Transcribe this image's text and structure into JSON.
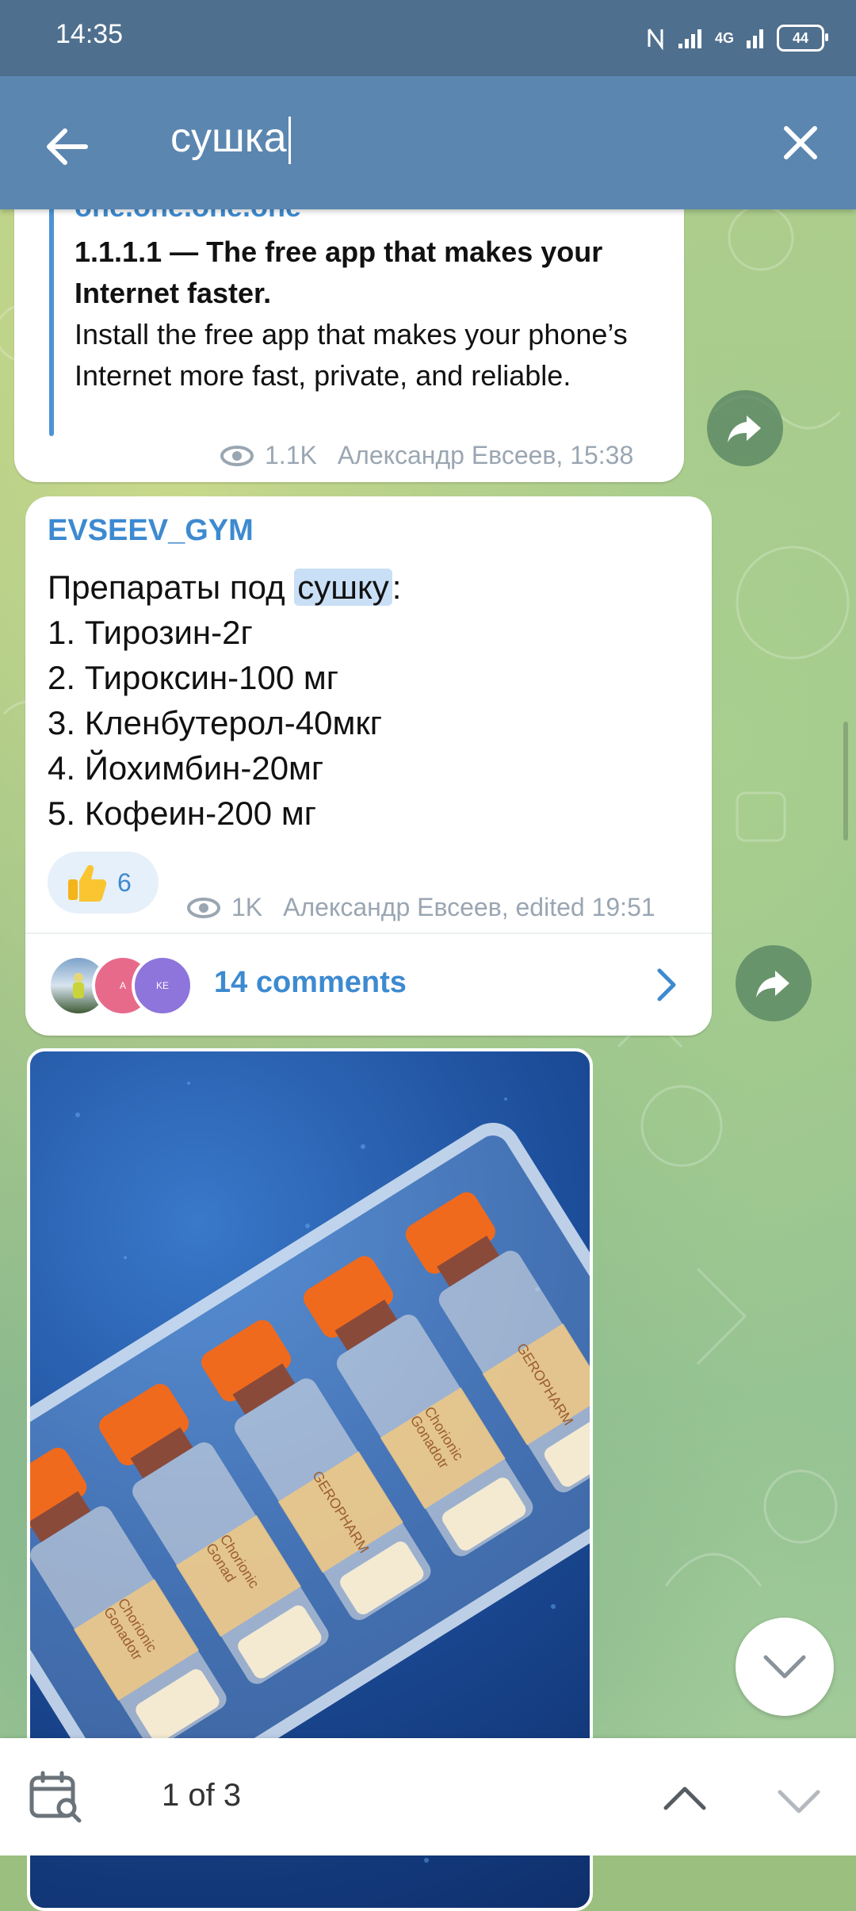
{
  "status_bar": {
    "time": "14:35",
    "network": "4G",
    "battery": "44"
  },
  "search": {
    "query": "сушка"
  },
  "link_preview": {
    "site": "one.one.one.one",
    "title": "1.1.1.1 — The free app that makes your Internet faster.",
    "description": "Install the free app that makes your phone’s Internet more fast, private, and reliable.",
    "views": "1.1K",
    "author_time": "Александр Евсеев, 15:38"
  },
  "post": {
    "channel": "EVSEEV_GYM",
    "line1_before": "Препараты под ",
    "line1_highlight": "сушку",
    "line1_after": ":",
    "items": [
      "1. Тирозин-2г",
      "2. Тироксин-100 мг",
      "3. Кленбутерол-40мкг",
      "4. Йохимбин-20мг",
      "5. Кофеин-200 мг"
    ],
    "reaction_count": "6",
    "views": "1K",
    "author_time": "Александр Евсеев, edited 19:51",
    "avatar_a": "A",
    "avatar_ke": "KE",
    "comments": "14 comments"
  },
  "photo_vials": {
    "labels": [
      "Chorionic Gonadotr",
      "Chorionic Gonad",
      "GEROPHARM",
      "Chorionic Gonadotr",
      "GEROPHARM"
    ]
  },
  "bottom": {
    "counter": "1 of 3"
  },
  "colors": {
    "header": "#5b86b0",
    "status": "#4f6f8e",
    "accent": "#3d8ad0"
  }
}
